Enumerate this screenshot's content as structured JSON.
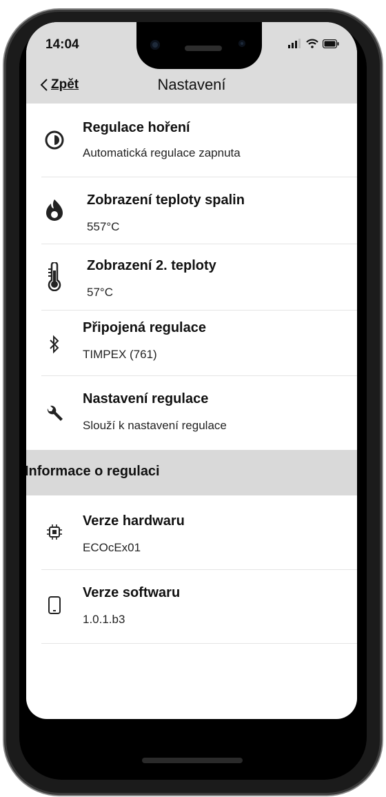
{
  "status_bar": {
    "time": "14:04"
  },
  "nav": {
    "back_label": "Zpět",
    "title": "Nastavení"
  },
  "settings": [
    {
      "title": "Regulace hoření",
      "subtitle": "Automatická regulace zapnuta",
      "icon": "half-moon-icon"
    },
    {
      "title": "Zobrazení teploty spalin",
      "subtitle": "557°C",
      "icon": "flame-icon"
    },
    {
      "title": "Zobrazení 2. teploty",
      "subtitle": "57°C",
      "icon": "thermometer-icon"
    },
    {
      "title": "Připojená regulace",
      "subtitle": "TIMPEX (761)",
      "icon": "bluetooth-icon"
    },
    {
      "title": "Nastavení regulace",
      "subtitle": "Slouží k nastavení regulace",
      "icon": "wrench-icon"
    }
  ],
  "section": {
    "header": "Informace o regulaci"
  },
  "info": [
    {
      "title": "Verze hardwaru",
      "subtitle": "ECOcEx01",
      "icon": "chip-icon"
    },
    {
      "title": "Verze softwaru",
      "subtitle": "1.0.1.b3",
      "icon": "phone-icon"
    }
  ],
  "colors": {
    "header_bg": "#dcdcdc",
    "section_bg": "#d9d9d9",
    "text": "#111111"
  }
}
